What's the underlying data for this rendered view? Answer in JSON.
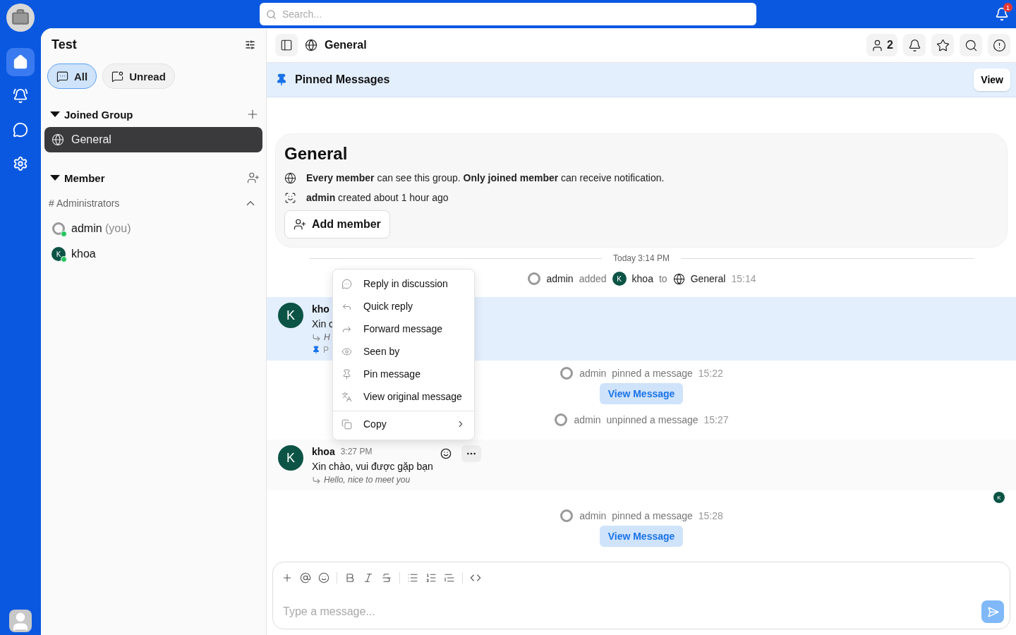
{
  "top_bar": {
    "search": {
      "placeholder": "Search..."
    },
    "notification_badge": "1"
  },
  "rail": {
    "items": [
      {
        "kind": "home",
        "selected": true
      },
      {
        "kind": "alerts",
        "selected": false
      },
      {
        "kind": "messages",
        "selected": false
      },
      {
        "kind": "settings",
        "selected": false
      }
    ]
  },
  "sidebar": {
    "title": "Test",
    "filters": [
      {
        "kind": "all",
        "label": "All",
        "selected": true
      },
      {
        "kind": "unread",
        "label": "Unread",
        "selected": false
      }
    ],
    "joined_group": {
      "title": "Joined Group",
      "expanded": true,
      "channels": [
        {
          "name": "General",
          "selected": true
        }
      ]
    },
    "member": {
      "title": "Member",
      "expanded": true,
      "groups": [
        {
          "title": "# Administrators",
          "expanded": true,
          "members": [
            {
              "name": "admin",
              "suffix": "(you)",
              "online": true
            },
            {
              "name": "khoa",
              "initial": "K",
              "online": true
            }
          ]
        }
      ]
    }
  },
  "header": {
    "title": "General",
    "actions": [
      {
        "kind": "members",
        "label": "2"
      },
      {
        "kind": "bell"
      },
      {
        "kind": "star"
      },
      {
        "kind": "search"
      },
      {
        "kind": "info"
      }
    ]
  },
  "pinned_bar": {
    "title": "Pinned Messages",
    "button": "View"
  },
  "intro": {
    "title": "General",
    "visibility": "**Every member** can see this group. **Only joined member** can receive notification.",
    "created": "**admin** created about 1 hour ago",
    "button": "Add member"
  },
  "timeline": [
    {
      "kind": "divider",
      "text": "Today 3:14 PM"
    },
    {
      "kind": "added",
      "actor": "admin",
      "verb": "added",
      "target_initial": "K",
      "target": "khoa",
      "prep": "to",
      "channel": "General",
      "time": "15:14"
    },
    {
      "kind": "message",
      "highlighted": true,
      "hovered": false,
      "initial": "K",
      "author": "kho",
      "text": "Xin c",
      "translation": "H",
      "pin_label": "P"
    },
    {
      "kind": "event",
      "actor": "admin",
      "verb": "pinned a message",
      "time": "15:22",
      "button": "View Message"
    },
    {
      "kind": "event",
      "actor": "admin",
      "verb": "unpinned a message",
      "time": "15:27"
    },
    {
      "kind": "message",
      "highlighted": false,
      "hovered": true,
      "initial": "K",
      "author": "khoa",
      "time": "3:27 PM",
      "text": "Xin chào, vui được gặp bạn",
      "translation": "Hello, nice to meet you"
    },
    {
      "kind": "receipt",
      "initial": "K"
    },
    {
      "kind": "event",
      "actor": "admin",
      "verb": "pinned a message",
      "time": "15:28",
      "button": "View Message"
    }
  ],
  "context_menu": {
    "items": [
      {
        "kind": "discussion",
        "label": "Reply in discussion",
        "submenu": false
      },
      {
        "kind": "reply",
        "label": "Quick reply",
        "submenu": false
      },
      {
        "kind": "forward",
        "label": "Forward message",
        "submenu": false
      },
      {
        "kind": "seen",
        "label": "Seen by",
        "submenu": false
      },
      {
        "kind": "pin",
        "label": "Pin message",
        "submenu": false
      },
      {
        "kind": "translate",
        "label": "View original message",
        "submenu": false
      },
      {
        "kind": "copy",
        "label": "Copy",
        "submenu": true
      }
    ]
  },
  "composer": {
    "placeholder": "Type a message...",
    "tools": [
      {
        "kind": "add"
      },
      {
        "kind": "mention"
      },
      {
        "kind": "emoji"
      },
      {
        "kind": "separator"
      },
      {
        "kind": "bold"
      },
      {
        "kind": "italic"
      },
      {
        "kind": "strike"
      },
      {
        "kind": "separator"
      },
      {
        "kind": "bullets"
      },
      {
        "kind": "numbers"
      },
      {
        "kind": "quote"
      },
      {
        "kind": "separator"
      },
      {
        "kind": "code"
      }
    ]
  }
}
